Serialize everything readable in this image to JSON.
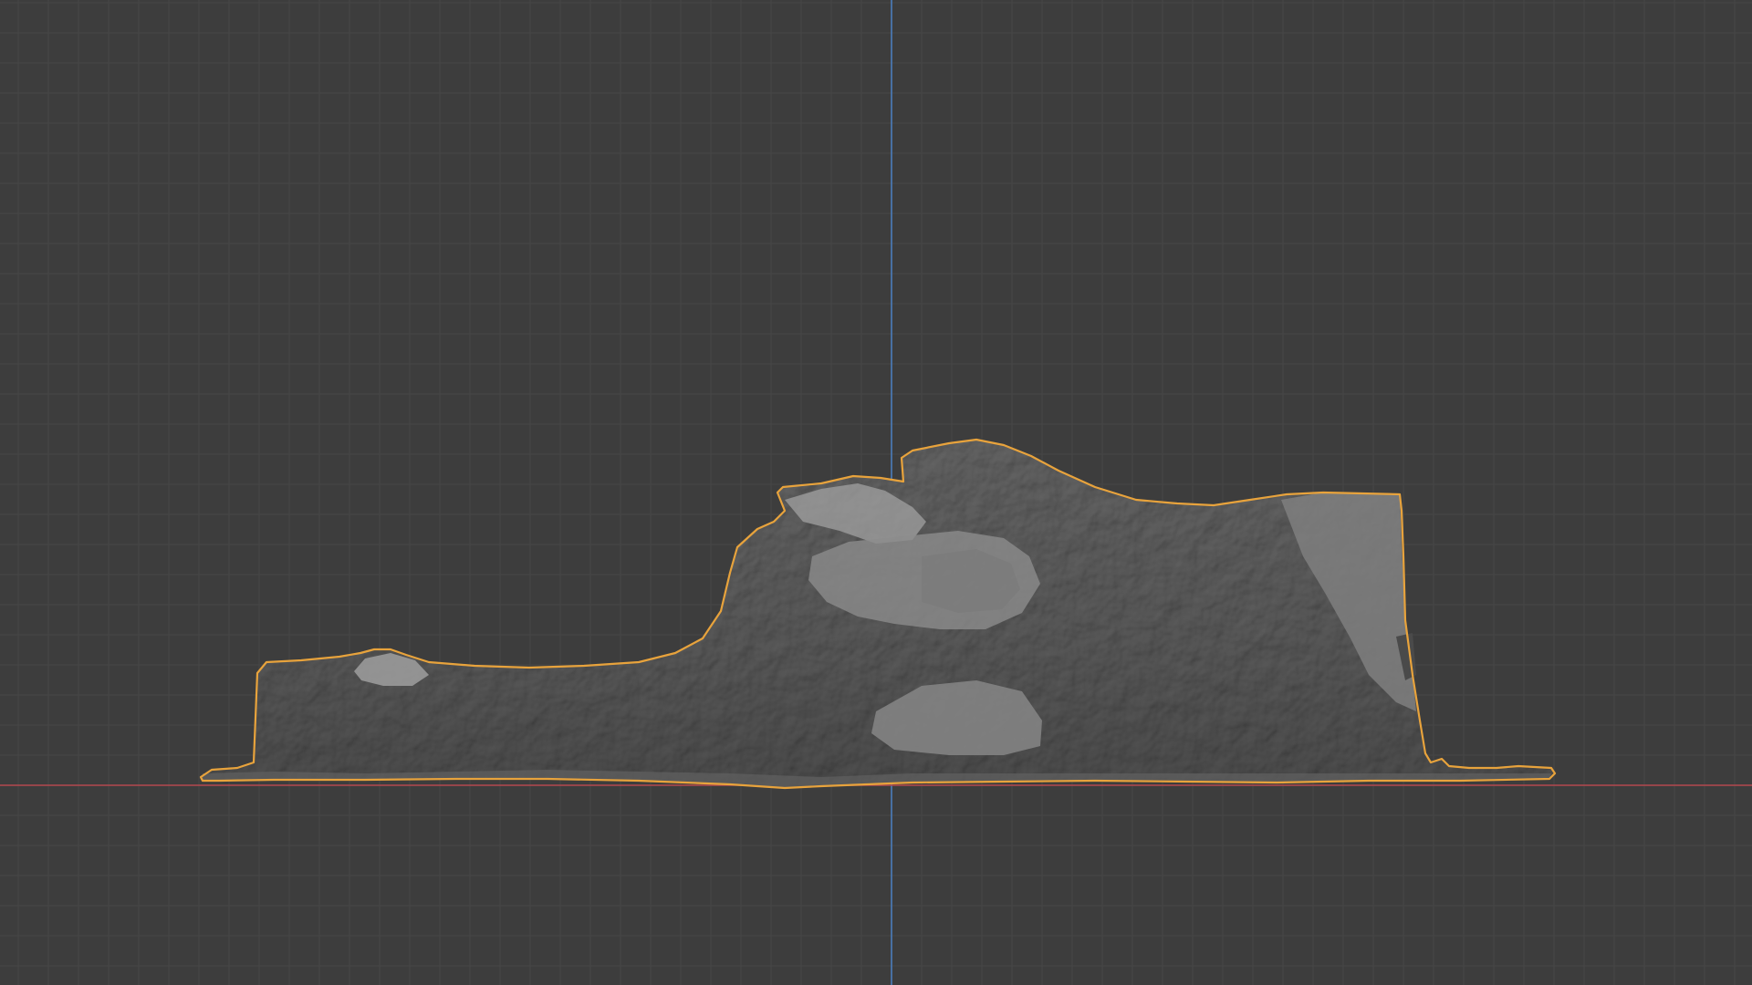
{
  "viewport": {
    "background_color": "#3d3d3d",
    "grid_minor_color": "#474747",
    "grid_major_color": "#525252",
    "x_axis_color": "#b4484f",
    "z_axis_color": "#4b7dbd"
  },
  "object": {
    "surface_color": "#8f8f8f",
    "shadow_color": "#6d6d6d",
    "selection_outline_color": "#e8a33c",
    "selected": true
  }
}
